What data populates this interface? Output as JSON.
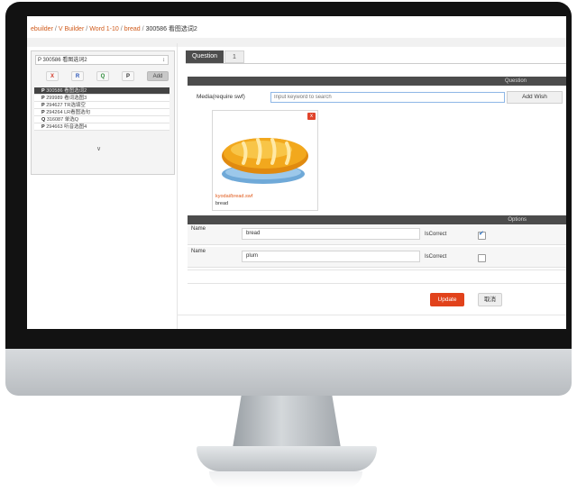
{
  "breadcrumb": {
    "items": [
      "ebuilder",
      "V Builder",
      "Word 1-10",
      "bread"
    ],
    "separator": "/",
    "current": "300586 看图选词2"
  },
  "left_panel": {
    "selector_value": "P 300586 看图选词2",
    "selector_caret": "↕",
    "tool_buttons": [
      "X",
      "R",
      "Q",
      "P"
    ],
    "add_label": "Add",
    "questions": [
      {
        "prefix": "P",
        "text": "300586 看图选词2",
        "selected": true
      },
      {
        "prefix": "P",
        "text": "299989 看词选图3",
        "selected": false
      },
      {
        "prefix": "P",
        "text": "294627 TR选填空",
        "selected": false
      },
      {
        "prefix": "P",
        "text": "294264 LR看图选句",
        "selected": false
      },
      {
        "prefix": "Q",
        "text": "316087 单选Q",
        "selected": false
      },
      {
        "prefix": "P",
        "text": "294663 听音选图4",
        "selected": false
      }
    ],
    "more_icon": "∨"
  },
  "tabs": {
    "question_label": "Question",
    "number_label": "1"
  },
  "question_section": {
    "header": "Question",
    "media_label": "Media(require swf)",
    "search_placeholder": "Input keyword to search",
    "add_wish_label": "Add Wish",
    "media_item": {
      "close_label": "x",
      "path": "kyodai/bread.swf",
      "name": "bread"
    }
  },
  "options_section": {
    "header": "Options",
    "rows": [
      {
        "name_label": "Name",
        "value": "bread",
        "correct_label": "IsCorrect",
        "checked": true
      },
      {
        "name_label": "Name",
        "value": "plum",
        "correct_label": "IsCorrect",
        "checked": false
      }
    ]
  },
  "actions": {
    "update_label": "Update",
    "cancel_label": "取消"
  },
  "colors": {
    "accent": "#e1421b",
    "header_bg": "#4c4c4c",
    "breadcrumb_link": "#d05a1a"
  }
}
